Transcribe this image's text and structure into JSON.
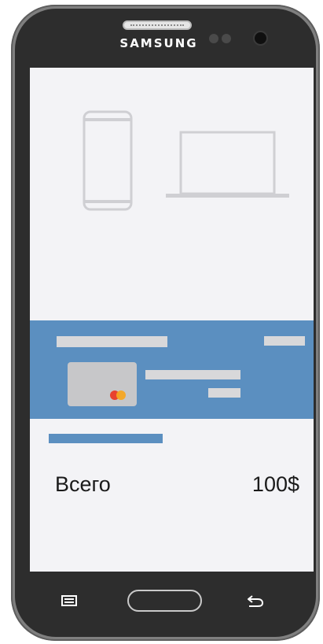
{
  "device": {
    "brand": "SAMSUNG"
  },
  "checkout": {
    "total_label": "Всего",
    "total_value": "100$"
  },
  "colors": {
    "accent": "#5b8fc0",
    "screen_background": "#f3f3f6",
    "placeholder": "#d8d8da",
    "phone_body": "#2d2d2d"
  },
  "icons": {
    "phone": "smartphone-outline-icon",
    "laptop": "laptop-outline-icon",
    "card_logo": "mastercard-logo-icon",
    "menu": "menu-key-icon",
    "home": "home-button",
    "back": "back-arrow-icon"
  }
}
